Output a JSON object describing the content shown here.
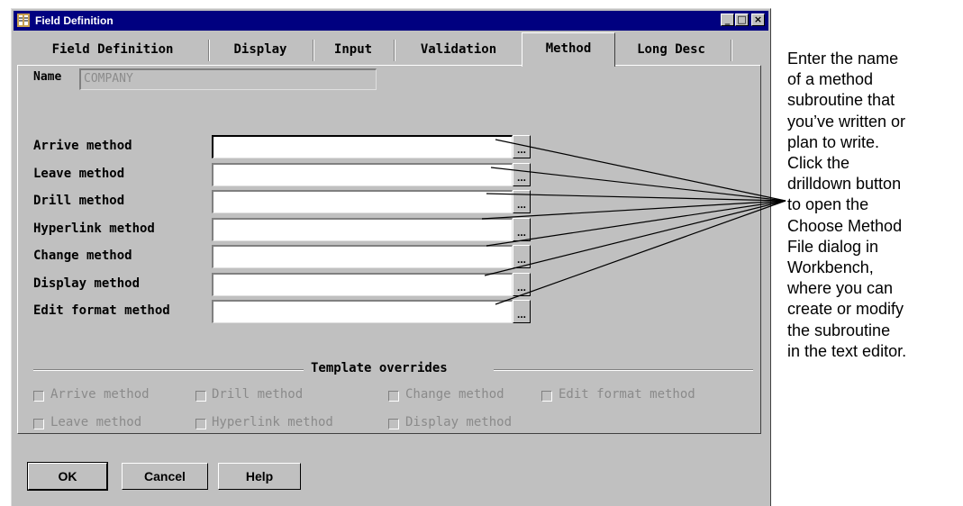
{
  "window": {
    "title": "Field Definition",
    "controls": [
      "_",
      "□",
      "×"
    ]
  },
  "tabs": [
    {
      "label": "Field Definition",
      "active": false
    },
    {
      "label": "Display",
      "active": false
    },
    {
      "label": "Input",
      "active": false
    },
    {
      "label": "Validation",
      "active": false
    },
    {
      "label": "Method",
      "active": true
    },
    {
      "label": "Long Desc",
      "active": false
    }
  ],
  "name_field": {
    "label": "Name",
    "value": "COMPANY"
  },
  "methods": [
    {
      "label": "Arrive method",
      "value": ""
    },
    {
      "label": "Leave method",
      "value": ""
    },
    {
      "label": "Drill method",
      "value": ""
    },
    {
      "label": "Hyperlink method",
      "value": ""
    },
    {
      "label": "Change method",
      "value": ""
    },
    {
      "label": "Display method",
      "value": ""
    },
    {
      "label": "Edit format method",
      "value": ""
    }
  ],
  "drilldown_label": "...",
  "template_overrides": {
    "title": "Template overrides",
    "checkboxes": [
      {
        "label": "Arrive method",
        "checked": false,
        "enabled": false
      },
      {
        "label": "Drill method",
        "checked": false,
        "enabled": false
      },
      {
        "label": "Change method",
        "checked": false,
        "enabled": false
      },
      {
        "label": "Edit format method",
        "checked": false,
        "enabled": false
      },
      {
        "label": "Leave method",
        "checked": false,
        "enabled": false
      },
      {
        "label": "Hyperlink method",
        "checked": false,
        "enabled": false
      },
      {
        "label": "Display method",
        "checked": false,
        "enabled": false
      }
    ]
  },
  "buttons": {
    "ok": "OK",
    "cancel": "Cancel",
    "help": "Help"
  },
  "callout": {
    "lines": [
      "Enter the name",
      "of a method",
      "subroutine that",
      "you’ve written or",
      "plan to write.",
      "Click the",
      "drilldown button",
      "to open the",
      "Choose Method",
      "File dialog in",
      "Workbench,",
      "where you can",
      "create or modify",
      "the subroutine",
      "in the text editor."
    ]
  },
  "colors": {
    "titlebar": "#000080",
    "dialog": "#c0c0c0",
    "disabled_text": "#8a8a8a"
  }
}
